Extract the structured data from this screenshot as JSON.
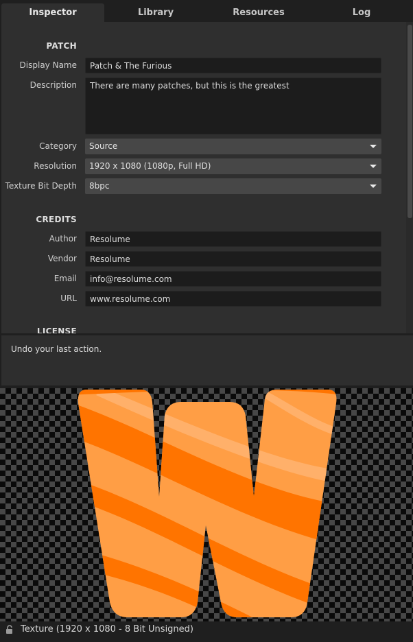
{
  "tabs": [
    {
      "label": "Inspector",
      "active": true
    },
    {
      "label": "Library",
      "active": false
    },
    {
      "label": "Resources",
      "active": false
    },
    {
      "label": "Log",
      "active": false
    }
  ],
  "patch": {
    "heading": "PATCH",
    "display_name_label": "Display Name",
    "display_name_value": "Patch & The Furious",
    "description_label": "Description",
    "description_value": "There are many patches, but this is the greatest",
    "category_label": "Category",
    "category_value": "Source",
    "resolution_label": "Resolution",
    "resolution_value": "1920 x 1080 (1080p, Full HD)",
    "bitdepth_label": "Texture Bit Depth",
    "bitdepth_value": "8bpc"
  },
  "credits": {
    "heading": "CREDITS",
    "author_label": "Author",
    "author_value": "Resolume",
    "vendor_label": "Vendor",
    "vendor_value": "Resolume",
    "email_label": "Email",
    "email_value": "info@resolume.com",
    "url_label": "URL",
    "url_value": "www.resolume.com"
  },
  "license": {
    "heading": "LICENSE"
  },
  "help": {
    "text": "Undo your last action."
  },
  "preview": {
    "status_text": "Texture (1920 x 1080 - 8 Bit Unsigned)",
    "lock_icon": "lock-icon",
    "glyph_color_light": "#ff9e45",
    "glyph_color_dark": "#ff7400"
  }
}
